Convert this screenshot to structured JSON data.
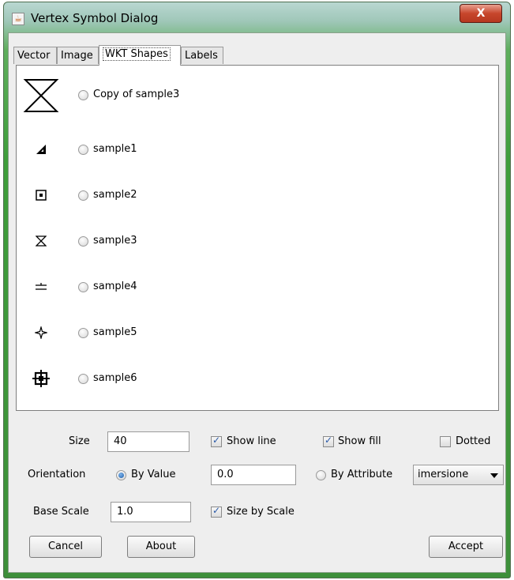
{
  "window": {
    "title": "Vertex Symbol Dialog",
    "close_label": "X",
    "app_icon": "java-cup-icon"
  },
  "tabs": [
    {
      "label": "Vector",
      "active": false
    },
    {
      "label": "Image",
      "active": false
    },
    {
      "label": "WKT Shapes",
      "active": true
    },
    {
      "label": "Labels",
      "active": false
    }
  ],
  "shapes": [
    {
      "label": "Copy of sample3",
      "icon": "hourglass-large-icon",
      "selected": false
    },
    {
      "label": "sample1",
      "icon": "triangle-icon",
      "selected": false
    },
    {
      "label": "sample2",
      "icon": "square-dot-icon",
      "selected": false
    },
    {
      "label": "sample3",
      "icon": "hourglass-icon",
      "selected": false
    },
    {
      "label": "sample4",
      "icon": "double-line-icon",
      "selected": false
    },
    {
      "label": "sample5",
      "icon": "star-icon",
      "selected": false
    },
    {
      "label": "sample6",
      "icon": "crosshair-square-icon",
      "selected": false
    }
  ],
  "controls": {
    "size_label": "Size",
    "size_value": "40",
    "show_line_label": "Show line",
    "show_line_checked": true,
    "show_fill_label": "Show fill",
    "show_fill_checked": true,
    "dotted_label": "Dotted",
    "dotted_checked": false,
    "orientation_label": "Orientation",
    "by_value_label": "By Value",
    "by_value_selected": true,
    "orientation_value": "0.0",
    "by_attribute_label": "By Attribute",
    "by_attribute_selected": false,
    "attribute_value": "imersione",
    "base_scale_label": "Base Scale",
    "base_scale_value": "1.0",
    "size_by_scale_label": "Size by Scale",
    "size_by_scale_checked": true
  },
  "buttons": {
    "cancel": "Cancel",
    "about": "About",
    "accept": "Accept"
  },
  "colors": {
    "title_frame": "#3f9e3b",
    "close_button": "#c7462c",
    "radio_selected": "#1d5ea8",
    "checkbox_check": "#2a5aa8"
  }
}
